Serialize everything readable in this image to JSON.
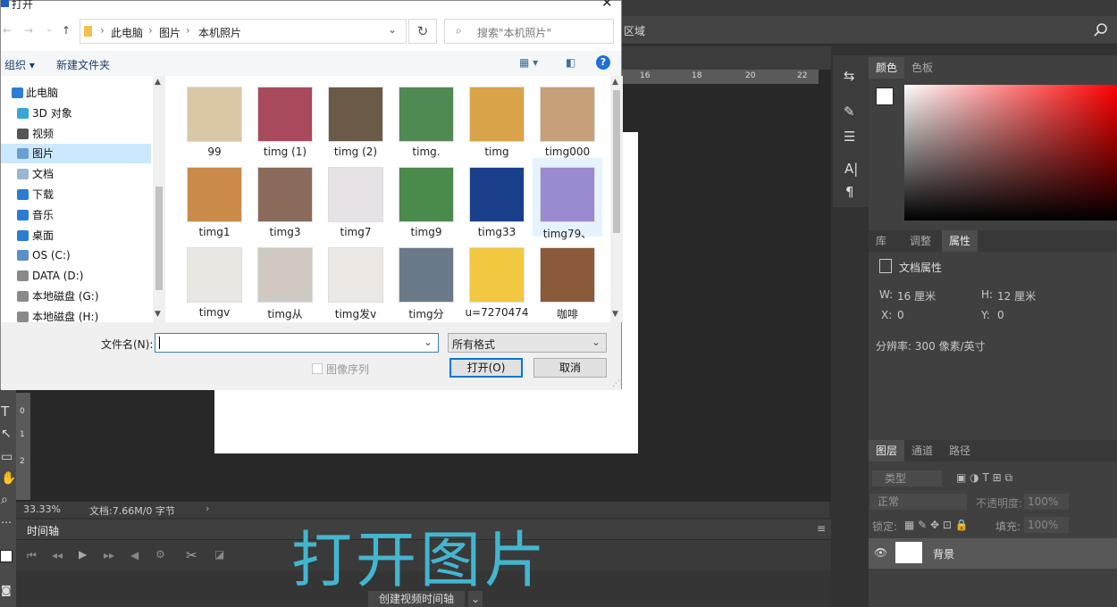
{
  "dialog": {
    "title": "打开",
    "breadcrumb": [
      "此电脑",
      "图片",
      "本机照片"
    ],
    "search_placeholder": "搜索\"本机照片\"",
    "toolbar": {
      "organize": "组织 ▾",
      "new_folder": "新建文件夹"
    },
    "sidebar": [
      {
        "label": "此电脑",
        "color": "#2b7cd3"
      },
      {
        "label": "3D 对象",
        "color": "#37a6d8"
      },
      {
        "label": "视频",
        "color": "#555555"
      },
      {
        "label": "图片",
        "color": "#6a9fd3"
      },
      {
        "label": "文档",
        "color": "#9ab6d0"
      },
      {
        "label": "下载",
        "color": "#2b7cd3"
      },
      {
        "label": "音乐",
        "color": "#2b7cd3"
      },
      {
        "label": "桌面",
        "color": "#2b7cd3"
      },
      {
        "label": "OS (C:)",
        "color": "#5a8fc8"
      },
      {
        "label": "DATA (D:)",
        "color": "#8a8a8a"
      },
      {
        "label": "本地磁盘 (G:)",
        "color": "#8a8a8a"
      },
      {
        "label": "本地磁盘 (H:)",
        "color": "#8a8a8a"
      }
    ],
    "files": [
      {
        "name": "99",
        "color": "#d9c7a6"
      },
      {
        "name": "timg (1)",
        "color": "#a84a5c"
      },
      {
        "name": "timg (2)",
        "color": "#6b5a48"
      },
      {
        "name": "timg.",
        "color": "#4f8a52"
      },
      {
        "name": "timg",
        "color": "#d9a34a"
      },
      {
        "name": "timg000",
        "color": "#c7a07a"
      },
      {
        "name": "timg1",
        "color": "#c98a4a"
      },
      {
        "name": "timg3",
        "color": "#8a6a5a"
      },
      {
        "name": "timg7",
        "color": "#e8e2e6"
      },
      {
        "name": "timg9",
        "color": "#4a8a4a"
      },
      {
        "name": "timg33",
        "color": "#1a3f8a"
      },
      {
        "name": "timg79、",
        "color": "#9a8ad0"
      },
      {
        "name": "timgv",
        "color": "#eae7e2"
      },
      {
        "name": "timg从",
        "color": "#cfc9c2"
      },
      {
        "name": "timg发v",
        "color": "#ece7e2"
      },
      {
        "name": "timg分",
        "color": "#6a7a8a"
      },
      {
        "name": "u=7270474",
        "color": "#f2c840"
      },
      {
        "name": "咖啡",
        "color": "#8a5a3a"
      }
    ],
    "filename_label": "文件名(N):",
    "filename_value": "",
    "filetype_value": "所有格式",
    "sequence_label": "图像序列",
    "open_button": "打开(O)",
    "cancel_button": "取消"
  },
  "ps": {
    "menu_fragment": "区域",
    "ruler_h": [
      "16",
      "18",
      "20",
      "22"
    ],
    "ruler_v": [
      "0",
      "1",
      "2"
    ],
    "zoom": "33.33%",
    "doc_info": "文档:7.66M/0 字节",
    "timeline_tab": "时间轴",
    "create_timeline": "创建视频时间轴",
    "color_tabs": [
      "颜色",
      "色板"
    ],
    "props_tabs": [
      "库",
      "调整",
      "属性"
    ],
    "doc_props_title": "文档属性",
    "w_label": "W:",
    "w_value": "16 厘米",
    "h_label": "H:",
    "h_value": "12 厘米",
    "x_label": "X:",
    "x_value": "0",
    "y_label": "Y:",
    "y_value": "0",
    "resolution": "分辨率: 300 像素/英寸",
    "layers_tabs": [
      "图层",
      "通道",
      "路径"
    ],
    "layer_filter": "类型",
    "blend_mode": "正常",
    "opacity_label": "不透明度:",
    "opacity_value": "100%",
    "lock_label": "锁定:",
    "fill_label": "填充:",
    "fill_value": "100%",
    "layer_name": "背景"
  },
  "overlay_caption": "打开图片"
}
